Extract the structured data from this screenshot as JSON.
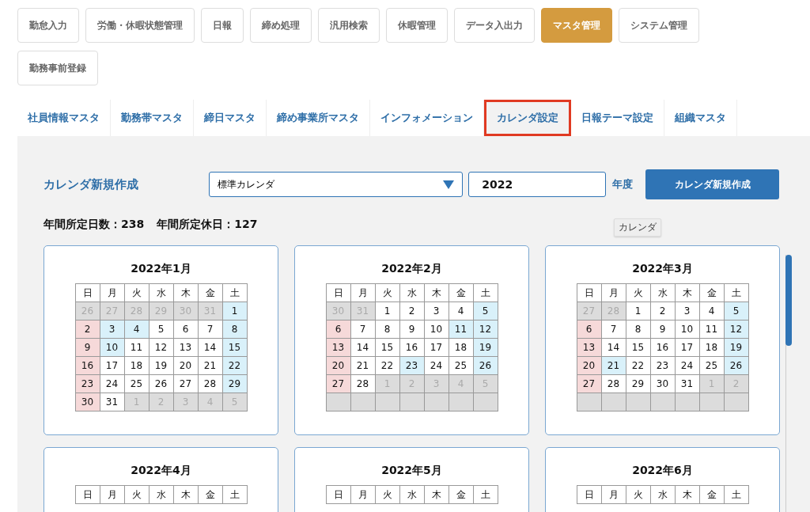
{
  "menu": [
    {
      "label": "勤怠入力",
      "selected": false
    },
    {
      "label": "労働・休暇状態管理",
      "selected": false
    },
    {
      "label": "日報",
      "selected": false
    },
    {
      "label": "締め処理",
      "selected": false
    },
    {
      "label": "汎用検索",
      "selected": false
    },
    {
      "label": "休暇管理",
      "selected": false
    },
    {
      "label": "データ入出力",
      "selected": false
    },
    {
      "label": "マスタ管理",
      "selected": true
    },
    {
      "label": "システム管理",
      "selected": false
    },
    {
      "label": "勤務事前登録",
      "selected": false
    }
  ],
  "tabs": [
    {
      "label": "社員情報マスタ",
      "selected": false
    },
    {
      "label": "勤務帯マスタ",
      "selected": false
    },
    {
      "label": "締日マスタ",
      "selected": false
    },
    {
      "label": "締め事業所マスタ",
      "selected": false
    },
    {
      "label": "インフォメーション",
      "selected": false
    },
    {
      "label": "カレンダ設定",
      "selected": true
    },
    {
      "label": "日報テーマ設定",
      "selected": false
    },
    {
      "label": "組織マスタ",
      "selected": false
    }
  ],
  "form": {
    "title": "カレンダ新規作成",
    "select": "標準カレンダ",
    "year": "2022",
    "year_unit": "年度",
    "button": "カレンダ新規作成"
  },
  "stats": [
    {
      "label": "年間所定日数：238"
    },
    {
      "label": "年間所定休日：127"
    }
  ],
  "tooltip": "カレンダ",
  "calendars": [
    {
      "title": "2022年1月",
      "weekdays": [
        "日",
        "月",
        "火",
        "水",
        "木",
        "金",
        "土"
      ],
      "weeks": [
        [
          {
            "day": "26",
            "kind": "other"
          },
          {
            "day": "27",
            "kind": "other"
          },
          {
            "day": "28",
            "kind": "other"
          },
          {
            "day": "29",
            "kind": "other"
          },
          {
            "day": "30",
            "kind": "other"
          },
          {
            "day": "31",
            "kind": "other"
          },
          {
            "day": "1",
            "kind": "holiday"
          }
        ],
        [
          {
            "day": "2",
            "kind": "sunday"
          },
          {
            "day": "3",
            "kind": "holiday"
          },
          {
            "day": "4",
            "kind": "holiday"
          },
          {
            "day": "5",
            "kind": "normal"
          },
          {
            "day": "6",
            "kind": "normal"
          },
          {
            "day": "7",
            "kind": "normal"
          },
          {
            "day": "8",
            "kind": "holiday"
          }
        ],
        [
          {
            "day": "9",
            "kind": "sunday"
          },
          {
            "day": "10",
            "kind": "holiday"
          },
          {
            "day": "11",
            "kind": "normal"
          },
          {
            "day": "12",
            "kind": "normal"
          },
          {
            "day": "13",
            "kind": "normal"
          },
          {
            "day": "14",
            "kind": "normal"
          },
          {
            "day": "15",
            "kind": "holiday"
          }
        ],
        [
          {
            "day": "16",
            "kind": "sunday"
          },
          {
            "day": "17",
            "kind": "normal"
          },
          {
            "day": "18",
            "kind": "normal"
          },
          {
            "day": "19",
            "kind": "normal"
          },
          {
            "day": "20",
            "kind": "normal"
          },
          {
            "day": "21",
            "kind": "normal"
          },
          {
            "day": "22",
            "kind": "holiday"
          }
        ],
        [
          {
            "day": "23",
            "kind": "sunday"
          },
          {
            "day": "24",
            "kind": "normal"
          },
          {
            "day": "25",
            "kind": "normal"
          },
          {
            "day": "26",
            "kind": "normal"
          },
          {
            "day": "27",
            "kind": "normal"
          },
          {
            "day": "28",
            "kind": "normal"
          },
          {
            "day": "29",
            "kind": "holiday"
          }
        ],
        [
          {
            "day": "30",
            "kind": "sunday"
          },
          {
            "day": "31",
            "kind": "normal"
          },
          {
            "day": "1",
            "kind": "other"
          },
          {
            "day": "2",
            "kind": "other"
          },
          {
            "day": "3",
            "kind": "other"
          },
          {
            "day": "4",
            "kind": "other"
          },
          {
            "day": "5",
            "kind": "other"
          }
        ]
      ]
    },
    {
      "title": "2022年2月",
      "weekdays": [
        "日",
        "月",
        "火",
        "水",
        "木",
        "金",
        "土"
      ],
      "weeks": [
        [
          {
            "day": "30",
            "kind": "other"
          },
          {
            "day": "31",
            "kind": "other"
          },
          {
            "day": "1",
            "kind": "normal"
          },
          {
            "day": "2",
            "kind": "normal"
          },
          {
            "day": "3",
            "kind": "normal"
          },
          {
            "day": "4",
            "kind": "normal"
          },
          {
            "day": "5",
            "kind": "holiday"
          }
        ],
        [
          {
            "day": "6",
            "kind": "sunday"
          },
          {
            "day": "7",
            "kind": "normal"
          },
          {
            "day": "8",
            "kind": "normal"
          },
          {
            "day": "9",
            "kind": "normal"
          },
          {
            "day": "10",
            "kind": "normal"
          },
          {
            "day": "11",
            "kind": "holiday"
          },
          {
            "day": "12",
            "kind": "holiday"
          }
        ],
        [
          {
            "day": "13",
            "kind": "sunday"
          },
          {
            "day": "14",
            "kind": "normal"
          },
          {
            "day": "15",
            "kind": "normal"
          },
          {
            "day": "16",
            "kind": "normal"
          },
          {
            "day": "17",
            "kind": "normal"
          },
          {
            "day": "18",
            "kind": "normal"
          },
          {
            "day": "19",
            "kind": "holiday"
          }
        ],
        [
          {
            "day": "20",
            "kind": "sunday"
          },
          {
            "day": "21",
            "kind": "normal"
          },
          {
            "day": "22",
            "kind": "normal"
          },
          {
            "day": "23",
            "kind": "holiday"
          },
          {
            "day": "24",
            "kind": "normal"
          },
          {
            "day": "25",
            "kind": "normal"
          },
          {
            "day": "26",
            "kind": "holiday"
          }
        ],
        [
          {
            "day": "27",
            "kind": "sunday"
          },
          {
            "day": "28",
            "kind": "normal"
          },
          {
            "day": "1",
            "kind": "other"
          },
          {
            "day": "2",
            "kind": "other"
          },
          {
            "day": "3",
            "kind": "other"
          },
          {
            "day": "4",
            "kind": "other"
          },
          {
            "day": "5",
            "kind": "other"
          }
        ],
        [
          {
            "kind": "empty"
          },
          {
            "kind": "empty"
          },
          {
            "kind": "empty"
          },
          {
            "kind": "empty"
          },
          {
            "kind": "empty"
          },
          {
            "kind": "empty"
          },
          {
            "kind": "empty"
          }
        ]
      ]
    },
    {
      "title": "2022年3月",
      "weekdays": [
        "日",
        "月",
        "火",
        "水",
        "木",
        "金",
        "土"
      ],
      "weeks": [
        [
          {
            "day": "27",
            "kind": "other"
          },
          {
            "day": "28",
            "kind": "other"
          },
          {
            "day": "1",
            "kind": "normal"
          },
          {
            "day": "2",
            "kind": "normal"
          },
          {
            "day": "3",
            "kind": "normal"
          },
          {
            "day": "4",
            "kind": "normal"
          },
          {
            "day": "5",
            "kind": "holiday"
          }
        ],
        [
          {
            "day": "6",
            "kind": "sunday"
          },
          {
            "day": "7",
            "kind": "normal"
          },
          {
            "day": "8",
            "kind": "normal"
          },
          {
            "day": "9",
            "kind": "normal"
          },
          {
            "day": "10",
            "kind": "normal"
          },
          {
            "day": "11",
            "kind": "normal"
          },
          {
            "day": "12",
            "kind": "holiday"
          }
        ],
        [
          {
            "day": "13",
            "kind": "sunday"
          },
          {
            "day": "14",
            "kind": "normal"
          },
          {
            "day": "15",
            "kind": "normal"
          },
          {
            "day": "16",
            "kind": "normal"
          },
          {
            "day": "17",
            "kind": "normal"
          },
          {
            "day": "18",
            "kind": "normal"
          },
          {
            "day": "19",
            "kind": "holiday"
          }
        ],
        [
          {
            "day": "20",
            "kind": "sunday"
          },
          {
            "day": "21",
            "kind": "holiday"
          },
          {
            "day": "22",
            "kind": "normal"
          },
          {
            "day": "23",
            "kind": "normal"
          },
          {
            "day": "24",
            "kind": "normal"
          },
          {
            "day": "25",
            "kind": "normal"
          },
          {
            "day": "26",
            "kind": "holiday"
          }
        ],
        [
          {
            "day": "27",
            "kind": "sunday"
          },
          {
            "day": "28",
            "kind": "normal"
          },
          {
            "day": "29",
            "kind": "normal"
          },
          {
            "day": "30",
            "kind": "normal"
          },
          {
            "day": "31",
            "kind": "normal"
          },
          {
            "day": "1",
            "kind": "other"
          },
          {
            "day": "2",
            "kind": "other"
          }
        ],
        [
          {
            "kind": "empty"
          },
          {
            "kind": "empty"
          },
          {
            "kind": "empty"
          },
          {
            "kind": "empty"
          },
          {
            "kind": "empty"
          },
          {
            "kind": "empty"
          },
          {
            "kind": "empty"
          }
        ]
      ]
    },
    {
      "title": "2022年4月",
      "weekdays": [
        "日",
        "月",
        "火",
        "水",
        "木",
        "金",
        "土"
      ]
    },
    {
      "title": "2022年5月",
      "weekdays": [
        "日",
        "月",
        "火",
        "水",
        "木",
        "金",
        "土"
      ]
    },
    {
      "title": "2022年6月",
      "weekdays": [
        "日",
        "月",
        "火",
        "水",
        "木",
        "金",
        "土"
      ]
    }
  ]
}
